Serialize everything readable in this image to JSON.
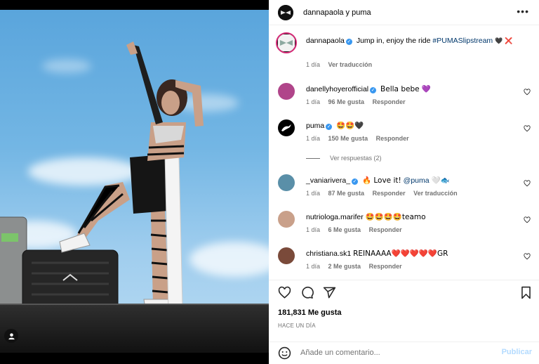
{
  "header": {
    "title": "dannapaola y puma",
    "more_icon": "ellipsis-icon"
  },
  "caption": {
    "username": "dannapaola",
    "text": "Jump in, enjoy the ride",
    "hashtag": "#PUMASlipstream",
    "emojis": "🖤 ❌",
    "time": "1 día",
    "translate": "Ver traducción"
  },
  "comments": [
    {
      "username": "danellyhoyerofficial",
      "verified": true,
      "text": "Bella bebe 💜",
      "time": "1 día",
      "likes": "96 Me gusta",
      "reply": "Responder",
      "avatar_color": "#b0458a"
    },
    {
      "username": "puma",
      "verified": true,
      "text": "🤩🤩🖤",
      "time": "1 día",
      "likes": "150 Me gusta",
      "reply": "Responder",
      "avatar_color": "#000000"
    },
    {
      "username": "_vaniarivera_",
      "verified": true,
      "text": "🔥 Love it!",
      "mention": "@puma",
      "text_after": "🤍🐟",
      "time": "1 día",
      "likes": "87 Me gusta",
      "reply": "Responder",
      "translate": "Ver traducción",
      "avatar_color": "#5a8fa8"
    },
    {
      "username": "nutriologa.marifer",
      "verified": false,
      "text": "🤩🤩🤩🤩teamo",
      "time": "1 día",
      "likes": "6 Me gusta",
      "reply": "Responder",
      "avatar_color": "#c9a08a"
    },
    {
      "username": "christiana.sk1",
      "verified": false,
      "text": "REINAAAA❤️❤️❤️❤️❤️GR",
      "time": "1 día",
      "likes": "2 Me gusta",
      "reply": "Responder",
      "avatar_color": "#7a4a3a"
    }
  ],
  "view_replies": "Ver respuestas (2)",
  "actions": {
    "likes_count": "181,831 Me gusta",
    "time": "HACE UN DÍA"
  },
  "composer": {
    "placeholder": "Añade un comentario...",
    "post_label": "Publicar"
  },
  "colors": {
    "link": "#00376b",
    "verified": "#3897f0",
    "meta": "#737373",
    "post_disabled": "#b3dbff"
  }
}
